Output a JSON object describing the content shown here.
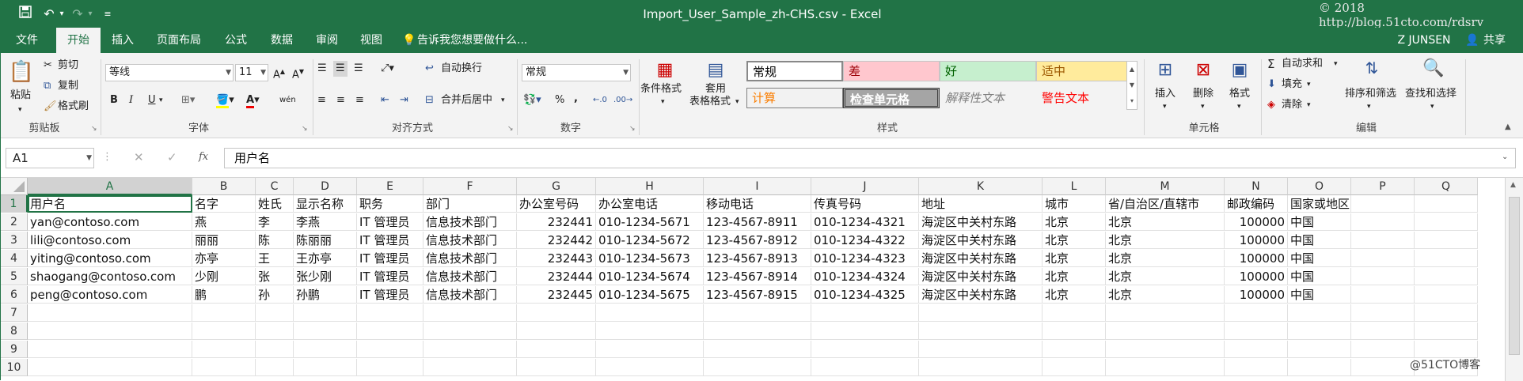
{
  "titlebar": {
    "title": "Import_User_Sample_zh-CHS.csv - Excel",
    "watermark": "© 2018 http://blog.51cto.com/rdsrv",
    "qat": {
      "save_icon": "save-icon",
      "undo_icon": "undo-icon",
      "redo_icon": "redo-icon",
      "customize_icon": "customize-icon"
    }
  },
  "tabs": {
    "file": "文件",
    "home": "开始",
    "insert": "插入",
    "layout": "页面布局",
    "formulas": "公式",
    "data": "数据",
    "review": "审阅",
    "view": "视图",
    "tellme": "告诉我您想要做什么...",
    "user": "Z JUNSEN",
    "share": "共享"
  },
  "ribbon": {
    "clipboard": {
      "paste": "粘贴",
      "cut": "剪切",
      "copy": "复制",
      "format_painter": "格式刷",
      "group": "剪贴板"
    },
    "font": {
      "name": "等线",
      "size": "11",
      "bold": "B",
      "italic": "I",
      "underline": "U",
      "phonetic": "wén",
      "group": "字体"
    },
    "alignment": {
      "wrap": "自动换行",
      "merge": "合并后居中",
      "group": "对齐方式"
    },
    "number": {
      "format": "常规",
      "percent": "%",
      "comma": ",",
      "group": "数字"
    },
    "styles": {
      "conditional": "条件格式",
      "table_fmt_1": "套用",
      "table_fmt_2": "表格格式",
      "normal": "常规",
      "bad": "差",
      "good": "好",
      "neutral": "适中",
      "calculation": "计算",
      "check_cell": "检查单元格",
      "explanatory": "解释性文本",
      "warning": "警告文本",
      "group": "样式"
    },
    "cells": {
      "insert": "插入",
      "delete": "删除",
      "format": "格式",
      "group": "单元格"
    },
    "editing": {
      "autosum": "自动求和",
      "fill": "填充",
      "clear": "清除",
      "sort": "排序和筛选",
      "find": "查找和选择",
      "group": "编辑"
    }
  },
  "formula": {
    "namebox": "A1",
    "fx": "fx",
    "content": "用户名"
  },
  "columns": [
    "A",
    "B",
    "C",
    "D",
    "E",
    "F",
    "G",
    "H",
    "I",
    "J",
    "K",
    "L",
    "M",
    "N",
    "O",
    "P",
    "Q"
  ],
  "rows": [
    "1",
    "2",
    "3",
    "4",
    "5",
    "6",
    "7",
    "8",
    "9",
    "10"
  ],
  "sheet": [
    [
      "用户名",
      "名字",
      "姓氏",
      "显示名称",
      "职务",
      "部门",
      "办公室号码",
      "办公室电话",
      "移动电话",
      "传真号码",
      "地址",
      "城市",
      "省/自治区/直辖市",
      "邮政编码",
      "国家或地区"
    ],
    [
      "yan@contoso.com",
      "燕",
      "李",
      "李燕",
      "IT 管理员",
      "信息技术部门",
      "232441",
      "010-1234-5671",
      "123-4567-8911",
      "010-1234-4321",
      "海淀区中关村东路",
      "北京",
      "北京",
      "100000",
      "中国"
    ],
    [
      "lili@contoso.com",
      "丽丽",
      "陈",
      "陈丽丽",
      "IT 管理员",
      "信息技术部门",
      "232442",
      "010-1234-5672",
      "123-4567-8912",
      "010-1234-4322",
      "海淀区中关村东路",
      "北京",
      "北京",
      "100000",
      "中国"
    ],
    [
      "yiting@contoso.com",
      "亦亭",
      "王",
      "王亦亭",
      "IT 管理员",
      "信息技术部门",
      "232443",
      "010-1234-5673",
      "123-4567-8913",
      "010-1234-4323",
      "海淀区中关村东路",
      "北京",
      "北京",
      "100000",
      "中国"
    ],
    [
      "shaogang@contoso.com",
      "少刚",
      "张",
      "张少刚",
      "IT 管理员",
      "信息技术部门",
      "232444",
      "010-1234-5674",
      "123-4567-8914",
      "010-1234-4324",
      "海淀区中关村东路",
      "北京",
      "北京",
      "100000",
      "中国"
    ],
    [
      "peng@contoso.com",
      "鹏",
      "孙",
      "孙鹏",
      "IT 管理员",
      "信息技术部门",
      "232445",
      "010-1234-5675",
      "123-4567-8915",
      "010-1234-4325",
      "海淀区中关村东路",
      "北京",
      "北京",
      "100000",
      "中国"
    ]
  ],
  "watermark_bottom": "@51CTO博客",
  "colors": {
    "excel_green": "#217346"
  }
}
